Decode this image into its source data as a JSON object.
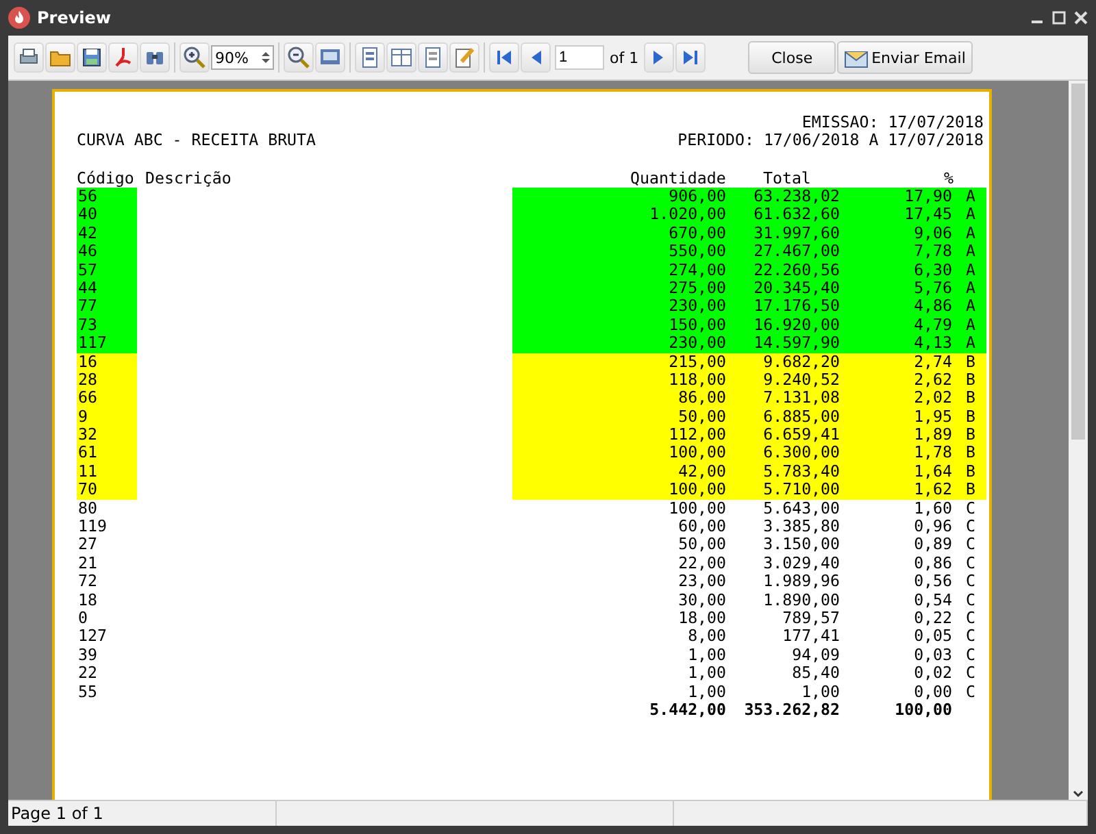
{
  "window": {
    "title": "Preview"
  },
  "toolbar": {
    "zoom": "90%",
    "page": "1",
    "page_count": "of 1",
    "buttons": [
      "Close",
      "Enviar Email"
    ]
  },
  "report": {
    "title": "CURVA ABC - RECEITA BRUTA",
    "emission": "EMISSAO: 17/07/2018",
    "period": "PERIODO: 17/06/2018 A 17/07/2018",
    "columns": [
      "Código",
      "Descrição",
      "Quantidade",
      "Total",
      "%"
    ],
    "rows": [
      {
        "code": "56",
        "quantity": "906,00",
        "total": "63.238,02",
        "percent": "17,90",
        "class": "A",
        "color": "#00ff00"
      },
      {
        "code": "40",
        "quantity": "1.020,00",
        "total": "61.632,60",
        "percent": "17,45",
        "class": "A",
        "color": "#00ff00"
      },
      {
        "code": "42",
        "quantity": "670,00",
        "total": "31.997,60",
        "percent": "9,06",
        "class": "A",
        "color": "#00ff00"
      },
      {
        "code": "46",
        "quantity": "550,00",
        "total": "27.467,00",
        "percent": "7,78",
        "class": "A",
        "color": "#00ff00"
      },
      {
        "code": "57",
        "quantity": "274,00",
        "total": "22.260,56",
        "percent": "6,30",
        "class": "A",
        "color": "#00ff00"
      },
      {
        "code": "44",
        "quantity": "275,00",
        "total": "20.345,40",
        "percent": "5,76",
        "class": "A",
        "color": "#00ff00"
      },
      {
        "code": "77",
        "quantity": "230,00",
        "total": "17.176,50",
        "percent": "4,86",
        "class": "A",
        "color": "#00ff00"
      },
      {
        "code": "73",
        "quantity": "150,00",
        "total": "16.920,00",
        "percent": "4,79",
        "class": "A",
        "color": "#00ff00"
      },
      {
        "code": "117",
        "quantity": "230,00",
        "total": "14.597,90",
        "percent": "4,13",
        "class": "A",
        "color": "#00ff00"
      },
      {
        "code": "16",
        "quantity": "215,00",
        "total": "9.682,20",
        "percent": "2,74",
        "class": "B",
        "color": "#ffff00"
      },
      {
        "code": "28",
        "quantity": "118,00",
        "total": "9.240,52",
        "percent": "2,62",
        "class": "B",
        "color": "#ffff00"
      },
      {
        "code": "66",
        "quantity": "86,00",
        "total": "7.131,08",
        "percent": "2,02",
        "class": "B",
        "color": "#ffff00"
      },
      {
        "code": "9",
        "quantity": "50,00",
        "total": "6.885,00",
        "percent": "1,95",
        "class": "B",
        "color": "#ffff00"
      },
      {
        "code": "32",
        "quantity": "112,00",
        "total": "6.659,41",
        "percent": "1,89",
        "class": "B",
        "color": "#ffff00"
      },
      {
        "code": "61",
        "quantity": "100,00",
        "total": "6.300,00",
        "percent": "1,78",
        "class": "B",
        "color": "#ffff00"
      },
      {
        "code": "11",
        "quantity": "42,00",
        "total": "5.783,40",
        "percent": "1,64",
        "class": "B",
        "color": "#ffff00"
      },
      {
        "code": "70",
        "quantity": "100,00",
        "total": "5.710,00",
        "percent": "1,62",
        "class": "B",
        "color": "#ffff00"
      },
      {
        "code": "80",
        "quantity": "100,00",
        "total": "5.643,00",
        "percent": "1,60",
        "class": "C"
      },
      {
        "code": "119",
        "quantity": "60,00",
        "total": "3.385,80",
        "percent": "0,96",
        "class": "C"
      },
      {
        "code": "27",
        "quantity": "50,00",
        "total": "3.150,00",
        "percent": "0,89",
        "class": "C"
      },
      {
        "code": "21",
        "quantity": "22,00",
        "total": "3.029,40",
        "percent": "0,86",
        "class": "C"
      },
      {
        "code": "72",
        "quantity": "23,00",
        "total": "1.989,96",
        "percent": "0,56",
        "class": "C"
      },
      {
        "code": "18",
        "quantity": "30,00",
        "total": "1.890,00",
        "percent": "0,54",
        "class": "C"
      },
      {
        "code": "0",
        "quantity": "18,00",
        "total": "789,57",
        "percent": "0,22",
        "class": "C"
      },
      {
        "code": "127",
        "quantity": "8,00",
        "total": "177,41",
        "percent": "0,05",
        "class": "C"
      },
      {
        "code": "39",
        "quantity": "1,00",
        "total": "94,09",
        "percent": "0,03",
        "class": "C"
      },
      {
        "code": "22",
        "quantity": "1,00",
        "total": "85,40",
        "percent": "0,02",
        "class": "C"
      },
      {
        "code": "55",
        "quantity": "1,00",
        "total": "1,00",
        "percent": "0,00",
        "class": "C"
      }
    ],
    "totals": {
      "quantity": "5.442,00",
      "total": "353.262,82",
      "percent": "100,00"
    }
  },
  "status_bar": {
    "text": "Page 1 of 1"
  }
}
